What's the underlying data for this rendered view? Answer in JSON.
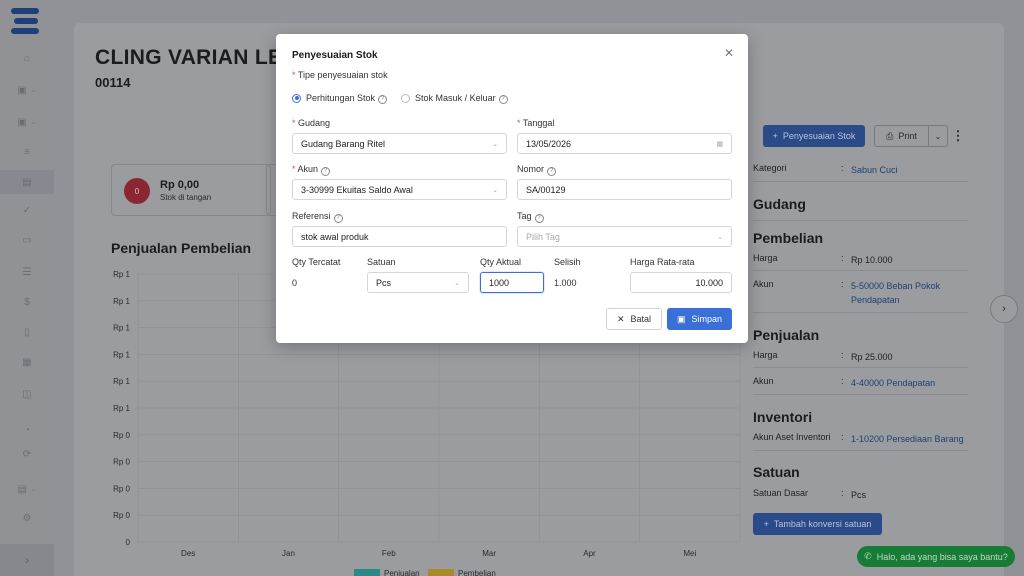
{
  "page": {
    "product_title": "CLING VARIAN LEI",
    "product_code": "00114",
    "stock_card": {
      "icon_text": "0",
      "value": "Rp 0,00",
      "label": "Stok di tangan"
    },
    "chart_title": "Penjualan Pembelian"
  },
  "chart_data": {
    "type": "bar",
    "categories": [
      "Des",
      "Jan",
      "Feb",
      "Mar",
      "Apr",
      "Mei"
    ],
    "y_tick_labels": [
      "Rp 1",
      "Rp 1",
      "Rp 1",
      "Rp 1",
      "Rp 1",
      "Rp 1",
      "Rp 0",
      "Rp 0",
      "Rp 0",
      "Rp 0",
      "0"
    ],
    "series": [
      {
        "name": "Penjualan",
        "values": [
          0,
          0,
          0,
          0,
          0,
          0
        ],
        "color": "#2a8a85"
      },
      {
        "name": "Pembelian",
        "values": [
          0,
          0,
          0,
          0,
          0,
          0
        ],
        "color": "#a88a2a"
      }
    ],
    "legend": "bottom",
    "grid": true
  },
  "toolbar": {
    "adjust_label": "Penyesuaian Stok",
    "print_label": "Print"
  },
  "right_panel": {
    "kategori_key": "Kategori",
    "kategori_val": "Sabun Cuci",
    "gudang_head": "Gudang",
    "pembelian_head": "Pembelian",
    "pembelian_harga_key": "Harga",
    "pembelian_harga_val": "Rp 10.000",
    "pembelian_akun_key": "Akun",
    "pembelian_akun_val": "5-50000 Beban Pokok Pendapatan",
    "penjualan_head": "Penjualan",
    "penjualan_harga_key": "Harga",
    "penjualan_harga_val": "Rp 25.000",
    "penjualan_akun_key": "Akun",
    "penjualan_akun_val": "4-40000 Pendapatan",
    "inventori_head": "Inventori",
    "inventori_key": "Akun Aset Inventori",
    "inventori_val": "1-10200 Persediaan Barang",
    "satuan_head": "Satuan",
    "satuan_key": "Satuan Dasar",
    "satuan_val": "Pcs",
    "colon": ":",
    "konversi_label": "Tambah konversi satuan"
  },
  "chat_label": "Halo, ada yang bisa saya bantu?",
  "modal": {
    "title": "Penyesuaian Stok",
    "type_label": "Tipe penyesuaian stok",
    "radio_count": "Perhitungan Stok",
    "radio_inout": "Stok Masuk / Keluar",
    "gudang_label": "Gudang",
    "gudang_value": "Gudang Barang Ritel",
    "tanggal_label": "Tanggal",
    "tanggal_value": "13/05/2026",
    "akun_label": "Akun",
    "akun_value": "3-30999 Ekuitas Saldo Awal",
    "nomor_label": "Nomor",
    "nomor_value": "SA/00129",
    "referensi_label": "Referensi",
    "referensi_value": "stok awal produk",
    "tag_label": "Tag",
    "tag_placeholder": "Pilih Tag",
    "qty_tercatat_label": "Qty Tercatat",
    "qty_tercatat_value": "0",
    "satuan_label": "Satuan",
    "satuan_value": "Pcs",
    "qty_aktual_label": "Qty Aktual",
    "qty_aktual_value": "1000",
    "selisih_label": "Selisih",
    "selisih_value": "1.000",
    "harga_label": "Harga Rata-rata",
    "harga_value": "10.000",
    "cancel_label": "Batal",
    "save_label": "Simpan"
  }
}
